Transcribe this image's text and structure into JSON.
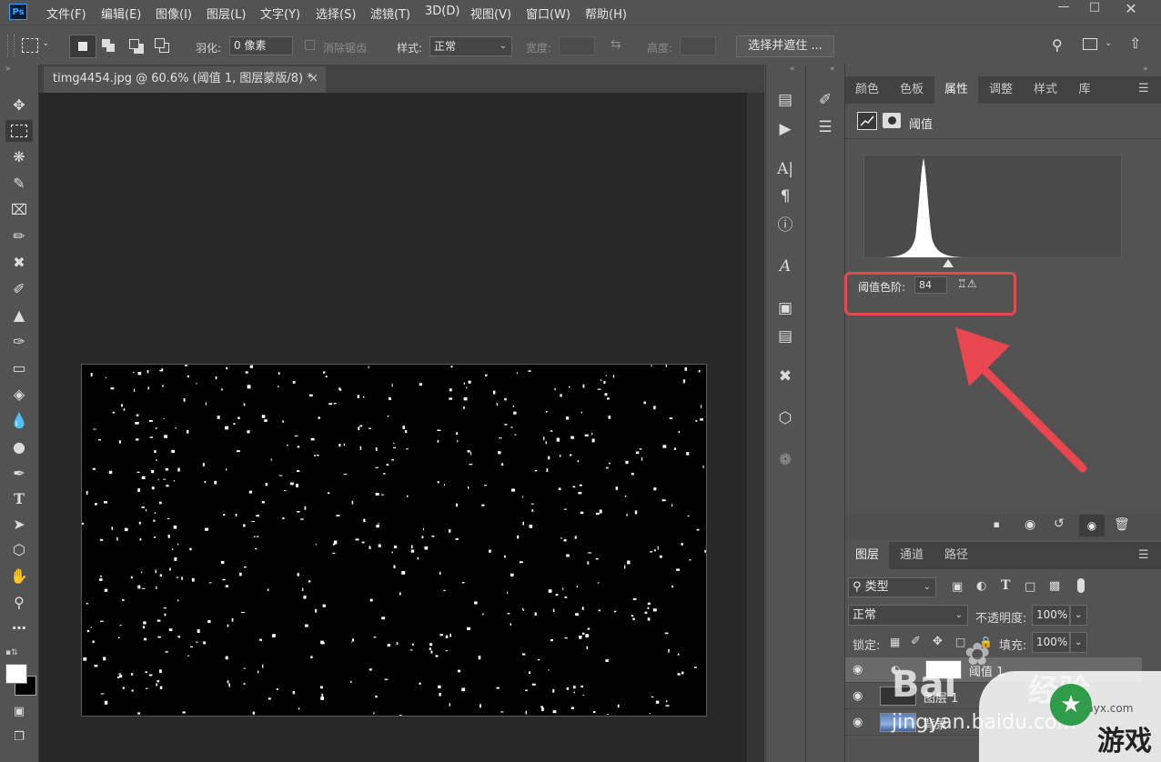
{
  "menubar": {
    "logo": "Ps",
    "items": [
      "文件(F)",
      "编辑(E)",
      "图像(I)",
      "图层(L)",
      "文字(Y)",
      "选择(S)",
      "滤镜(T)",
      "3D(D)",
      "视图(V)",
      "窗口(W)",
      "帮助(H)"
    ],
    "window_controls": [
      "minimize-icon",
      "restore-icon",
      "close-icon"
    ]
  },
  "options": {
    "feather_label": "羽化:",
    "feather_value": "0 像素",
    "antialias_label": "消除锯齿",
    "style_label": "样式:",
    "style_value": "正常",
    "width_label": "宽度:",
    "height_label": "高度:",
    "select_mask_label": "选择并遮住 ..."
  },
  "document": {
    "tab_title": "timg4454.jpg @ 60.6% (阈值 1, 图层蒙版/8) *",
    "tab_close": "×"
  },
  "properties": {
    "tabs": [
      "颜色",
      "色板",
      "属性",
      "调整",
      "样式",
      "库"
    ],
    "active_tab": "属性",
    "header": "阈值",
    "threshold_label": "阈值色阶:",
    "threshold_value": "84"
  },
  "layers": {
    "tabs": [
      "图层",
      "通道",
      "路径"
    ],
    "active_tab": "图层",
    "filter_value": "类型",
    "blend_mode": "正常",
    "opacity_label": "不透明度:",
    "opacity_value": "100%",
    "lock_label": "锁定:",
    "fill_label": "填充:",
    "fill_value": "100%",
    "rows": [
      "阈值 1",
      "图层 1",
      "背景"
    ]
  },
  "watermark": {
    "baidu_text": "Bai",
    "du_cn": "经验",
    "jingyan_url": "jingyan.baidu.com",
    "site_url": "xlayx.com",
    "site_name": "游戏"
  },
  "colors": {
    "accent_highlight": "#e04a50",
    "arrow": "#e8474f"
  }
}
